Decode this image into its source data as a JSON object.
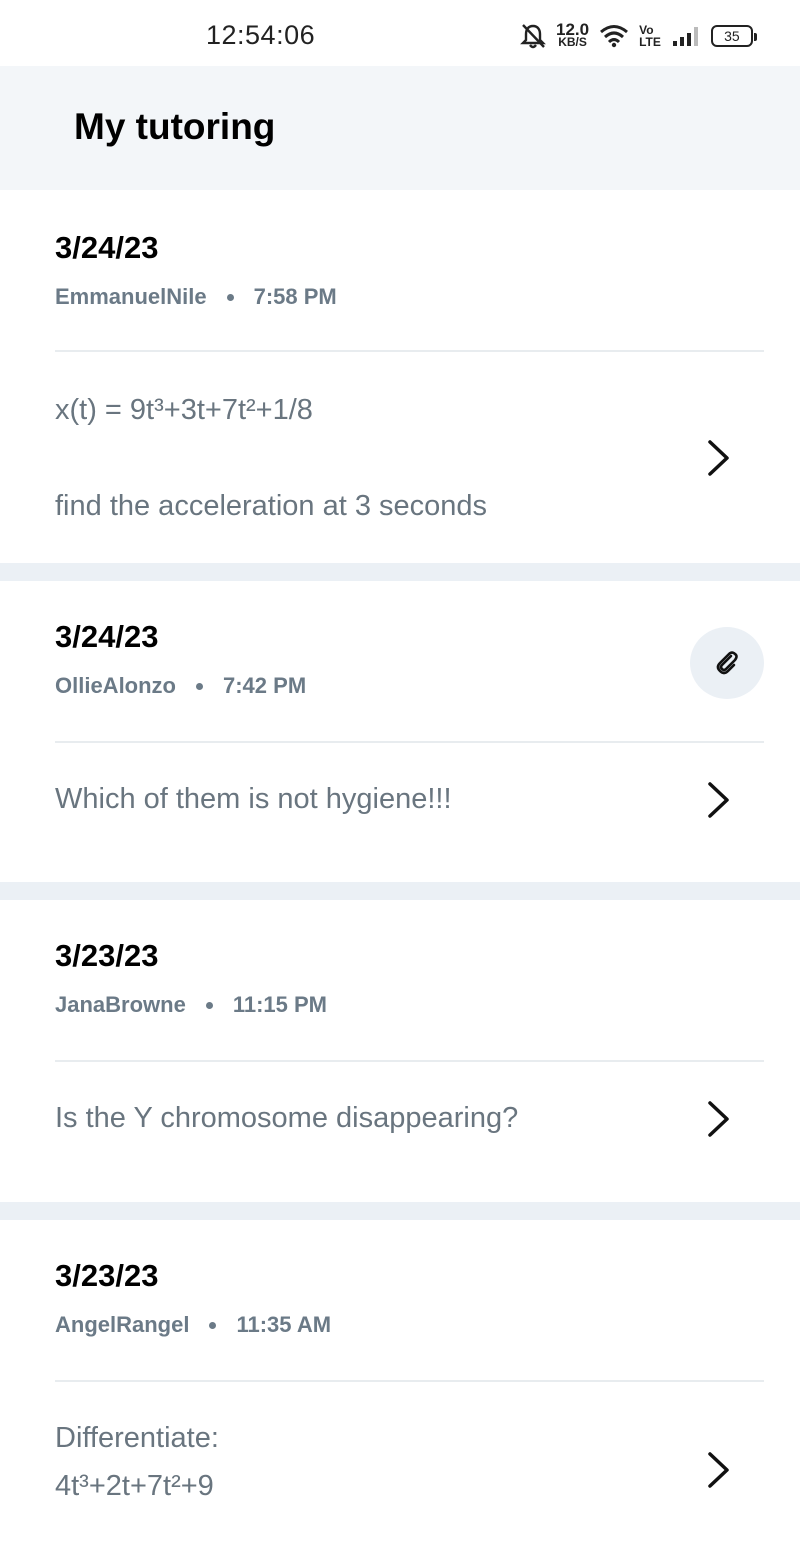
{
  "status_bar": {
    "time": "12:54:06",
    "net_speed_value": "12.0",
    "net_speed_unit": "KB/S",
    "volte_top": "Vo",
    "volte_bottom": "LTE",
    "battery": "35",
    "icons": [
      "bell-off-icon",
      "wifi-icon",
      "signal-icon",
      "battery-icon"
    ]
  },
  "header": {
    "title": "My tutoring"
  },
  "sessions": [
    {
      "date": "3/24/23",
      "tutor": "EmmanuelNile",
      "time": "7:58 PM",
      "question_line1": "x(t) = 9t³+3t+7t²+1/8",
      "question_line2": "find the acceleration at 3 seconds",
      "has_attachment": false
    },
    {
      "date": "3/24/23",
      "tutor": "OllieAlonzo",
      "time": "7:42 PM",
      "question_line1": "Which of them is not hygiene!!!",
      "has_attachment": true
    },
    {
      "date": "3/23/23",
      "tutor": "JanaBrowne",
      "time": "11:15 PM",
      "question_line1": "Is the Y chromosome disappearing?",
      "has_attachment": false
    },
    {
      "date": "3/23/23",
      "tutor": "AngelRangel",
      "time": "11:35 AM",
      "question_line1": "Differentiate:",
      "question_line2": "4t³+2t+7t²+9",
      "has_attachment": false
    }
  ],
  "colors": {
    "header_bg": "#f3f6f9",
    "separator": "#ebf0f5",
    "meta_text": "#6b7a87",
    "question_text": "#69757f"
  }
}
